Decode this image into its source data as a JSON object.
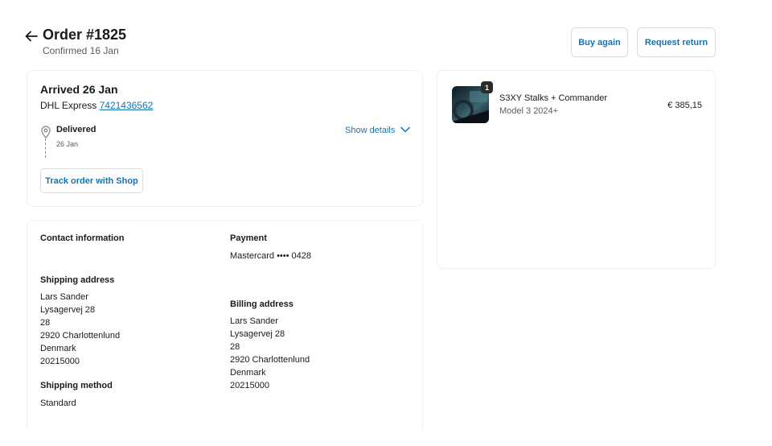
{
  "header": {
    "title": "Order #1825",
    "subtitle": "Confirmed 16 Jan",
    "buy_again_label": "Buy again",
    "request_return_label": "Request return"
  },
  "status": {
    "arrived": "Arrived 26 Jan",
    "carrier": "DHL Express",
    "tracking_number": "7421436562",
    "event_title": "Delivered",
    "event_date": "26 Jan",
    "show_details_label": "Show details",
    "track_button_label": "Track order with Shop"
  },
  "info": {
    "contact_label": "Contact information",
    "payment_label": "Payment",
    "payment_card": "Mastercard •••• 0428",
    "shipping_address_label": "Shipping address",
    "shipping_address": [
      "Lars Sander",
      "Lysagervej 28",
      "28",
      "2920 Charlottenlund",
      "Denmark",
      "20215000"
    ],
    "billing_address_label": "Billing address",
    "billing_address": [
      "Lars Sander",
      "Lysagervej 28",
      "28",
      "2920 Charlottenlund",
      "Denmark",
      "20215000"
    ],
    "shipping_method_label": "Shipping method",
    "shipping_method": "Standard"
  },
  "items": [
    {
      "quantity": "1",
      "name": "S3XY Stalks + Commander",
      "variant": "Model 3 2024+",
      "price": "€ 385,15"
    }
  ],
  "colors": {
    "link": "#1773b0",
    "text": "#1a1a1a",
    "muted": "#5c5c5c"
  },
  "icons": {
    "back": "arrow-left-icon",
    "location": "map-pin-icon",
    "chevron": "chevron-down-icon"
  }
}
